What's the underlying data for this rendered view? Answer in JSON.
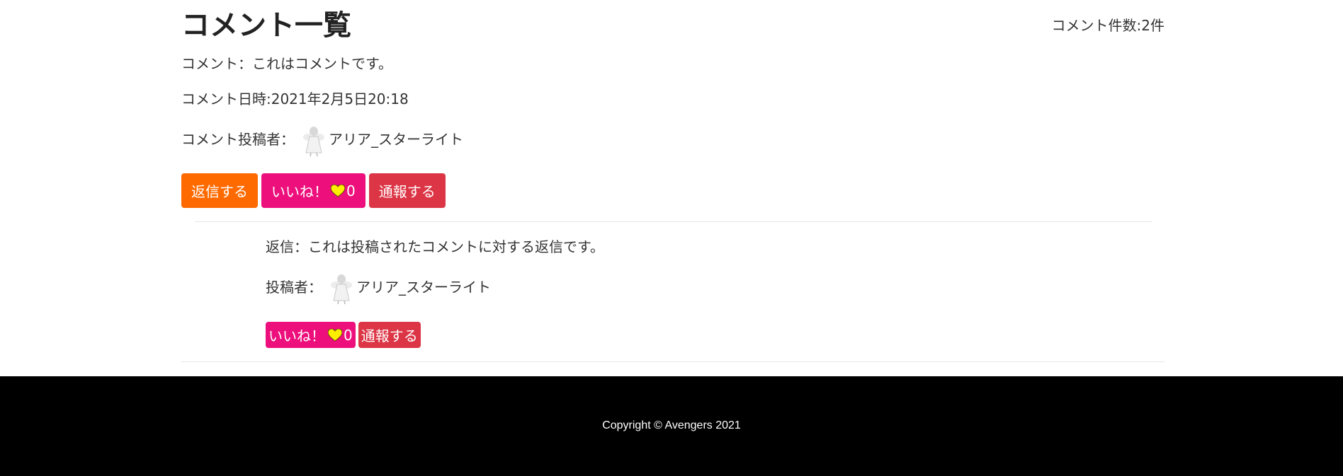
{
  "page": {
    "title": "コメント一覧",
    "comment_count": "コメント件数:2件"
  },
  "comment": {
    "text": "コメント：これはコメントです。",
    "date": "コメント日時:2021年2月5日20:18",
    "author_label": "コメント投稿者：",
    "author_name": "アリア_スターライト",
    "reply_button": "返信する",
    "like_label": "いいね！",
    "like_count": "0",
    "report_button": "通報する"
  },
  "reply": {
    "text": "返信：これは投稿されたコメントに対する返信です。",
    "author_label": "投稿者：",
    "author_name": "アリア_スターライト",
    "like_label": "いいね！",
    "like_count": "0",
    "report_button": "通報する"
  },
  "footer": {
    "copyright": "Copyright © Avengers 2021"
  },
  "colors": {
    "reply_button": "#ff6a00",
    "like_button": "#ec0f7c",
    "report_button": "#dc3545",
    "heart": "#ffee00",
    "footer_bg": "#000000"
  }
}
